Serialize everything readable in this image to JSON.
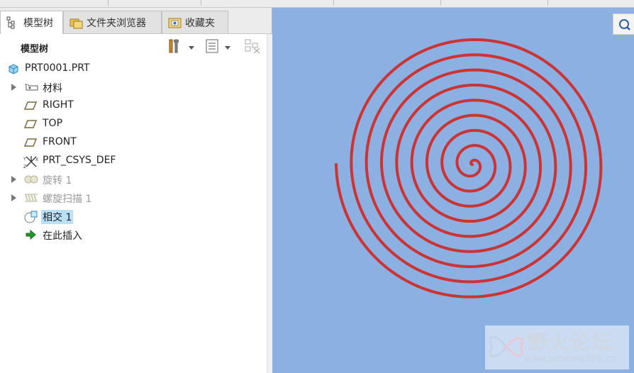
{
  "tabs": [
    {
      "label": "模型树",
      "icon": "model-tree-icon"
    },
    {
      "label": "文件夹浏览器",
      "icon": "folder-browser-icon"
    },
    {
      "label": "收藏夹",
      "icon": "favorites-icon"
    }
  ],
  "panel": {
    "title": "模型树"
  },
  "tree": {
    "root": "PRT0001.PRT",
    "items": [
      {
        "label": "材料",
        "icon": "material-tag-icon",
        "expandable": true,
        "dim": false
      },
      {
        "label": "RIGHT",
        "icon": "datum-plane-icon",
        "expandable": false,
        "dim": false
      },
      {
        "label": "TOP",
        "icon": "datum-plane-icon",
        "expandable": false,
        "dim": false
      },
      {
        "label": "FRONT",
        "icon": "datum-plane-icon",
        "expandable": false,
        "dim": false
      },
      {
        "label": "PRT_CSYS_DEF",
        "icon": "csys-icon",
        "expandable": false,
        "dim": false
      },
      {
        "label": "旋转 1",
        "icon": "revolve-icon",
        "expandable": true,
        "dim": true
      },
      {
        "label": "螺旋扫描 1",
        "icon": "helical-sweep-icon",
        "expandable": true,
        "dim": true
      },
      {
        "label": "相交 1",
        "icon": "intersect-icon",
        "expandable": false,
        "dim": false,
        "selected": true
      },
      {
        "label": "在此插入",
        "icon": "insert-here-arrow-icon",
        "expandable": false,
        "dim": false
      }
    ]
  },
  "viewport": {
    "background": "#8db0e2",
    "curve_color": "#cc3333",
    "curve": "spiral"
  },
  "watermark": {
    "title": "野火论坛",
    "url": "www.proewildfire.cn"
  }
}
